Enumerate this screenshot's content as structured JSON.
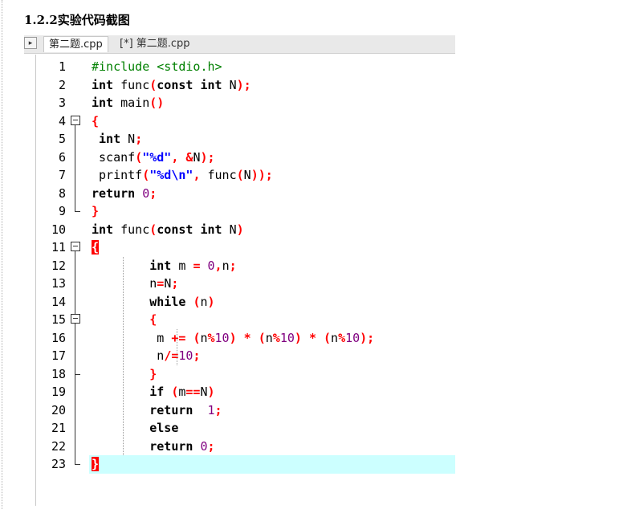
{
  "heading": "1.2.2实验代码截图",
  "tabs": [
    {
      "label": "第二题.cpp"
    },
    {
      "label": "[*] 第二题.cpp"
    }
  ],
  "colors": {
    "keyword": "#000000",
    "preprocessor": "#008000",
    "operator": "#ff0000",
    "string": "#0000ff",
    "number": "#800080",
    "current_line_highlight": "#ccffff"
  },
  "editor": {
    "lines": [
      {
        "num": "1",
        "tokens": [
          [
            "pp",
            "#include <stdio.h>"
          ]
        ]
      },
      {
        "num": "2",
        "tokens": [
          [
            "kw",
            "int"
          ],
          [
            "id",
            " func"
          ],
          [
            "op",
            "("
          ],
          [
            "kw",
            "const int"
          ],
          [
            "id",
            " N"
          ],
          [
            "op",
            ");"
          ]
        ]
      },
      {
        "num": "3",
        "tokens": [
          [
            "kw",
            "int"
          ],
          [
            "id",
            " main"
          ],
          [
            "op",
            "()"
          ]
        ]
      },
      {
        "num": "4",
        "tokens": [
          [
            "op",
            "{"
          ]
        ]
      },
      {
        "num": "5",
        "tokens": [
          [
            "id",
            " "
          ],
          [
            "kw",
            "int"
          ],
          [
            "id",
            " N"
          ],
          [
            "op",
            ";"
          ]
        ]
      },
      {
        "num": "6",
        "tokens": [
          [
            "id",
            " scanf"
          ],
          [
            "op",
            "("
          ],
          [
            "str",
            "\"%d\""
          ],
          [
            "op",
            ", &"
          ],
          [
            "id",
            "N"
          ],
          [
            "op",
            ");"
          ]
        ]
      },
      {
        "num": "7",
        "tokens": [
          [
            "id",
            " printf"
          ],
          [
            "op",
            "("
          ],
          [
            "str",
            "\"%d\\n\""
          ],
          [
            "op",
            ","
          ],
          [
            "id",
            " func"
          ],
          [
            "op",
            "("
          ],
          [
            "id",
            "N"
          ],
          [
            "op",
            "));"
          ]
        ]
      },
      {
        "num": "8",
        "tokens": [
          [
            "kw",
            "return"
          ],
          [
            "id",
            " "
          ],
          [
            "num",
            "0"
          ],
          [
            "op",
            ";"
          ]
        ]
      },
      {
        "num": "9",
        "tokens": [
          [
            "op",
            "}"
          ]
        ]
      },
      {
        "num": "10",
        "tokens": [
          [
            "kw",
            "int"
          ],
          [
            "id",
            " func"
          ],
          [
            "op",
            "("
          ],
          [
            "kw",
            "const int"
          ],
          [
            "id",
            " N"
          ],
          [
            "op",
            ")"
          ]
        ]
      },
      {
        "num": "11",
        "tokens": [
          [
            "brace",
            "{"
          ]
        ]
      },
      {
        "num": "12",
        "tokens": [
          [
            "id",
            "        "
          ],
          [
            "kw",
            "int"
          ],
          [
            "id",
            " m "
          ],
          [
            "op",
            "="
          ],
          [
            "id",
            " "
          ],
          [
            "num",
            "0"
          ],
          [
            "op",
            ","
          ],
          [
            "id",
            "n"
          ],
          [
            "op",
            ";"
          ]
        ]
      },
      {
        "num": "13",
        "tokens": [
          [
            "id",
            "        n"
          ],
          [
            "op",
            "="
          ],
          [
            "id",
            "N"
          ],
          [
            "op",
            ";"
          ]
        ]
      },
      {
        "num": "14",
        "tokens": [
          [
            "id",
            "        "
          ],
          [
            "kw",
            "while"
          ],
          [
            "id",
            " "
          ],
          [
            "op",
            "("
          ],
          [
            "id",
            "n"
          ],
          [
            "op",
            ")"
          ]
        ]
      },
      {
        "num": "15",
        "tokens": [
          [
            "id",
            "        "
          ],
          [
            "op",
            "{"
          ]
        ]
      },
      {
        "num": "16",
        "tokens": [
          [
            "id",
            "         m "
          ],
          [
            "op",
            "+="
          ],
          [
            "id",
            " "
          ],
          [
            "op",
            "("
          ],
          [
            "id",
            "n"
          ],
          [
            "op",
            "%"
          ],
          [
            "num",
            "10"
          ],
          [
            "op",
            ")"
          ],
          [
            "id",
            " "
          ],
          [
            "op",
            "*"
          ],
          [
            "id",
            " "
          ],
          [
            "op",
            "("
          ],
          [
            "id",
            "n"
          ],
          [
            "op",
            "%"
          ],
          [
            "num",
            "10"
          ],
          [
            "op",
            ")"
          ],
          [
            "id",
            " "
          ],
          [
            "op",
            "*"
          ],
          [
            "id",
            " "
          ],
          [
            "op",
            "("
          ],
          [
            "id",
            "n"
          ],
          [
            "op",
            "%"
          ],
          [
            "num",
            "10"
          ],
          [
            "op",
            ");"
          ]
        ]
      },
      {
        "num": "17",
        "tokens": [
          [
            "id",
            "         n"
          ],
          [
            "op",
            "/="
          ],
          [
            "num",
            "10"
          ],
          [
            "op",
            ";"
          ]
        ]
      },
      {
        "num": "18",
        "tokens": [
          [
            "id",
            "        "
          ],
          [
            "op",
            "}"
          ]
        ]
      },
      {
        "num": "19",
        "tokens": [
          [
            "id",
            "        "
          ],
          [
            "kw",
            "if"
          ],
          [
            "id",
            " "
          ],
          [
            "op",
            "("
          ],
          [
            "id",
            "m"
          ],
          [
            "op",
            "=="
          ],
          [
            "id",
            "N"
          ],
          [
            "op",
            ")"
          ]
        ]
      },
      {
        "num": "20",
        "tokens": [
          [
            "id",
            "        "
          ],
          [
            "kw",
            "return"
          ],
          [
            "id",
            "  "
          ],
          [
            "num",
            "1"
          ],
          [
            "op",
            ";"
          ]
        ]
      },
      {
        "num": "21",
        "tokens": [
          [
            "id",
            "        "
          ],
          [
            "kw",
            "else"
          ]
        ]
      },
      {
        "num": "22",
        "tokens": [
          [
            "id",
            "        "
          ],
          [
            "kw",
            "return"
          ],
          [
            "id",
            " "
          ],
          [
            "num",
            "0"
          ],
          [
            "op",
            ";"
          ]
        ]
      },
      {
        "num": "23",
        "tokens": [
          [
            "brace",
            "}"
          ]
        ]
      }
    ]
  }
}
